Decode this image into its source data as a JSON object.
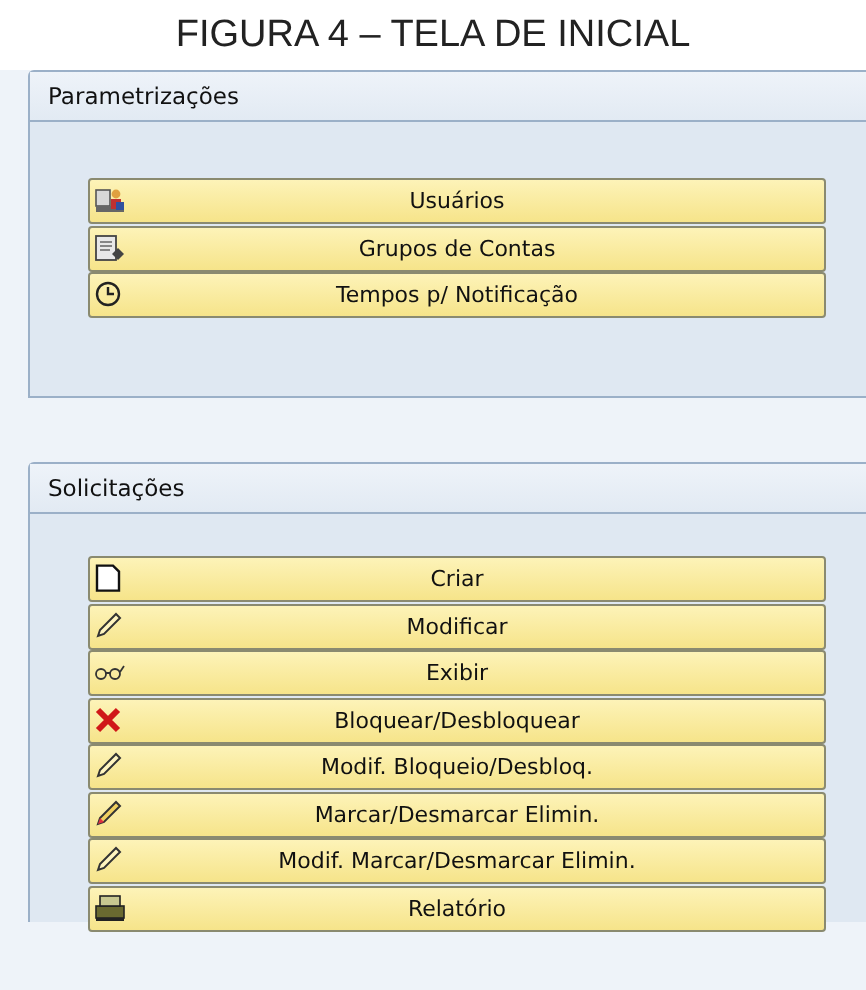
{
  "caption": "FIGURA 4 – TELA DE INICIAL",
  "panels": [
    {
      "title": "Parametrizações",
      "buttons": [
        {
          "label": "Usuários"
        },
        {
          "label": "Grupos de Contas"
        },
        {
          "label": "Tempos p/ Notificação"
        }
      ]
    },
    {
      "title": "Solicitações",
      "buttons": [
        {
          "label": "Criar"
        },
        {
          "label": "Modificar"
        },
        {
          "label": "Exibir"
        },
        {
          "label": "Bloquear/Desbloquear"
        },
        {
          "label": "Modif. Bloqueio/Desbloq."
        },
        {
          "label": "Marcar/Desmarcar Elimin."
        },
        {
          "label": "Modif. Marcar/Desmarcar Elimin."
        },
        {
          "label": "Relatório"
        }
      ]
    }
  ]
}
